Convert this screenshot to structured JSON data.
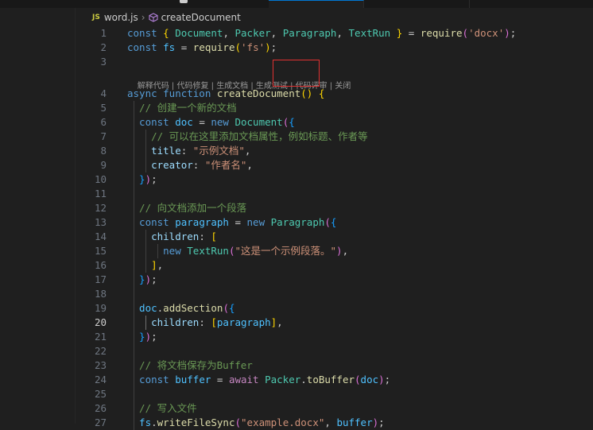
{
  "breadcrumb": {
    "file_badge": "JS",
    "file": "word.js",
    "symbol": "createDocument"
  },
  "codelens": [
    "解释代码",
    "代码修复",
    "生成文档",
    "生成测试",
    "代码评审",
    "关闭"
  ],
  "lines": [
    {
      "n": "1",
      "tokens": [
        [
          "kw",
          "const "
        ],
        [
          "b1",
          "{ "
        ],
        [
          "cls",
          "Document"
        ],
        [
          "pun",
          ", "
        ],
        [
          "cls",
          "Packer"
        ],
        [
          "pun",
          ", "
        ],
        [
          "cls",
          "Paragraph"
        ],
        [
          "pun",
          ", "
        ],
        [
          "cls",
          "TextRun"
        ],
        [
          "b1",
          " }"
        ],
        [
          "pun",
          " = "
        ],
        [
          "fn",
          "require"
        ],
        [
          "b2",
          "("
        ],
        [
          "str",
          "'docx'"
        ],
        [
          "b2",
          ")"
        ],
        [
          "pun",
          ";"
        ]
      ]
    },
    {
      "n": "2",
      "tokens": [
        [
          "kw",
          "const "
        ],
        [
          "var",
          "fs"
        ],
        [
          "pun",
          " = "
        ],
        [
          "fn",
          "require"
        ],
        [
          "b1",
          "("
        ],
        [
          "str",
          "'fs'"
        ],
        [
          "b1",
          ")"
        ],
        [
          "pun",
          ";"
        ]
      ]
    },
    {
      "n": "3",
      "tokens": []
    },
    {
      "n": "4",
      "tokens": [
        [
          "kw",
          "async function "
        ],
        [
          "fn",
          "createDocument"
        ],
        [
          "b1",
          "() {"
        ]
      ]
    },
    {
      "n": "5",
      "tokens": [
        [
          "cmt",
          "  // 创建一个新的文档"
        ]
      ]
    },
    {
      "n": "6",
      "tokens": [
        [
          "kw",
          "  const "
        ],
        [
          "var",
          "doc"
        ],
        [
          "pun",
          " = "
        ],
        [
          "kw",
          "new "
        ],
        [
          "cls",
          "Document"
        ],
        [
          "b2",
          "("
        ],
        [
          "b3",
          "{"
        ]
      ]
    },
    {
      "n": "7",
      "tokens": [
        [
          "cmt",
          "    // 可以在这里添加文档属性，例如标题、作者等"
        ]
      ]
    },
    {
      "n": "8",
      "tokens": [
        [
          "prop",
          "    title"
        ],
        [
          "pun",
          ": "
        ],
        [
          "str",
          "\"示例文档\""
        ],
        [
          "pun",
          ","
        ]
      ]
    },
    {
      "n": "9",
      "tokens": [
        [
          "prop",
          "    creator"
        ],
        [
          "pun",
          ": "
        ],
        [
          "str",
          "\"作者名\""
        ],
        [
          "pun",
          ","
        ]
      ]
    },
    {
      "n": "10",
      "tokens": [
        [
          "b3",
          "  }"
        ],
        [
          "b2",
          ")"
        ],
        [
          "pun",
          ";"
        ]
      ]
    },
    {
      "n": "11",
      "tokens": []
    },
    {
      "n": "12",
      "tokens": [
        [
          "cmt",
          "  // 向文档添加一个段落"
        ]
      ]
    },
    {
      "n": "13",
      "tokens": [
        [
          "kw",
          "  const "
        ],
        [
          "var",
          "paragraph"
        ],
        [
          "pun",
          " = "
        ],
        [
          "kw",
          "new "
        ],
        [
          "cls",
          "Paragraph"
        ],
        [
          "b2",
          "("
        ],
        [
          "b3",
          "{"
        ]
      ]
    },
    {
      "n": "14",
      "tokens": [
        [
          "prop",
          "    children"
        ],
        [
          "pun",
          ": "
        ],
        [
          "b1",
          "["
        ]
      ]
    },
    {
      "n": "15",
      "tokens": [
        [
          "kw",
          "      new "
        ],
        [
          "cls",
          "TextRun"
        ],
        [
          "b2",
          "("
        ],
        [
          "str",
          "\"这是一个示例段落。\""
        ],
        [
          "b2",
          ")"
        ],
        [
          "pun",
          ","
        ]
      ]
    },
    {
      "n": "16",
      "tokens": [
        [
          "b1",
          "    ]"
        ],
        [
          "pun",
          ","
        ]
      ]
    },
    {
      "n": "17",
      "tokens": [
        [
          "b3",
          "  }"
        ],
        [
          "b2",
          ")"
        ],
        [
          "pun",
          ";"
        ]
      ]
    },
    {
      "n": "18",
      "tokens": []
    },
    {
      "n": "19",
      "tokens": [
        [
          "var",
          "  doc"
        ],
        [
          "pun",
          "."
        ],
        [
          "fn",
          "addSection"
        ],
        [
          "b2",
          "("
        ],
        [
          "b3",
          "{"
        ]
      ]
    },
    {
      "n": "20",
      "tokens": [
        [
          "prop",
          "    children"
        ],
        [
          "pun",
          ": "
        ],
        [
          "b1",
          "["
        ],
        [
          "var",
          "paragraph"
        ],
        [
          "b1",
          "]"
        ],
        [
          "pun",
          ","
        ]
      ]
    },
    {
      "n": "21",
      "tokens": [
        [
          "b3",
          "  }"
        ],
        [
          "b2",
          ")"
        ],
        [
          "pun",
          ";"
        ]
      ]
    },
    {
      "n": "22",
      "tokens": []
    },
    {
      "n": "23",
      "tokens": [
        [
          "cmt",
          "  // 将文档保存为Buffer"
        ]
      ]
    },
    {
      "n": "24",
      "tokens": [
        [
          "kw",
          "  const "
        ],
        [
          "var",
          "buffer"
        ],
        [
          "pun",
          " = "
        ],
        [
          "kwc",
          "await "
        ],
        [
          "cls",
          "Packer"
        ],
        [
          "pun",
          "."
        ],
        [
          "fn",
          "toBuffer"
        ],
        [
          "b2",
          "("
        ],
        [
          "var",
          "doc"
        ],
        [
          "b2",
          ")"
        ],
        [
          "pun",
          ";"
        ]
      ]
    },
    {
      "n": "25",
      "tokens": []
    },
    {
      "n": "26",
      "tokens": [
        [
          "cmt",
          "  // 写入文件"
        ]
      ]
    },
    {
      "n": "27",
      "tokens": [
        [
          "var",
          "  fs"
        ],
        [
          "pun",
          "."
        ],
        [
          "fn",
          "writeFileSync"
        ],
        [
          "b2",
          "("
        ],
        [
          "str",
          "\"example.docx\""
        ],
        [
          "pun",
          ", "
        ],
        [
          "var",
          "buffer"
        ],
        [
          "b2",
          ")"
        ],
        [
          "pun",
          ";"
        ]
      ]
    }
  ],
  "current_line": "20"
}
